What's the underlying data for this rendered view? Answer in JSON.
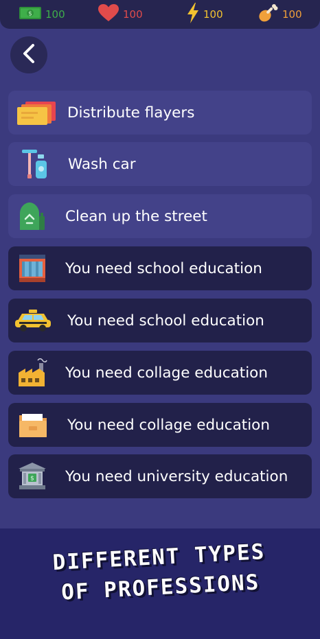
{
  "status_bar": {
    "money": {
      "value": "100",
      "icon": "cash-icon",
      "color": "#3fae4a"
    },
    "health": {
      "value": "100",
      "icon": "heart-icon",
      "color": "#e04b4b"
    },
    "energy": {
      "value": "100",
      "icon": "lightning-icon",
      "color": "#f2c230"
    },
    "food": {
      "value": "100",
      "icon": "chicken-leg-icon",
      "color": "#f0a03a"
    }
  },
  "navigation": {
    "back_icon": "chevron-left-icon"
  },
  "jobs": [
    {
      "label": "Distribute flayers",
      "icon": "tickets-icon",
      "locked": false
    },
    {
      "label": "Wash car",
      "icon": "cleaning-tools-icon",
      "locked": false
    },
    {
      "label": "Clean up the street",
      "icon": "recycling-bin-icon",
      "locked": false
    },
    {
      "label": "You need school education",
      "icon": "shop-icon",
      "locked": true
    },
    {
      "label": "You need school education",
      "icon": "taxi-icon",
      "locked": true
    },
    {
      "label": "You need collage education",
      "icon": "factory-icon",
      "locked": true
    },
    {
      "label": "You need collage education",
      "icon": "folder-icon",
      "locked": true
    },
    {
      "label": "You need university education",
      "icon": "bank-icon",
      "locked": true
    }
  ],
  "banner": {
    "line1": "DIFFERENT TYPES",
    "line2": "OF PROFESSIONS"
  },
  "colors": {
    "background": "#3b3a7e",
    "row_unlocked": "#434289",
    "row_locked": "#22214a",
    "top_bar": "#262550"
  }
}
